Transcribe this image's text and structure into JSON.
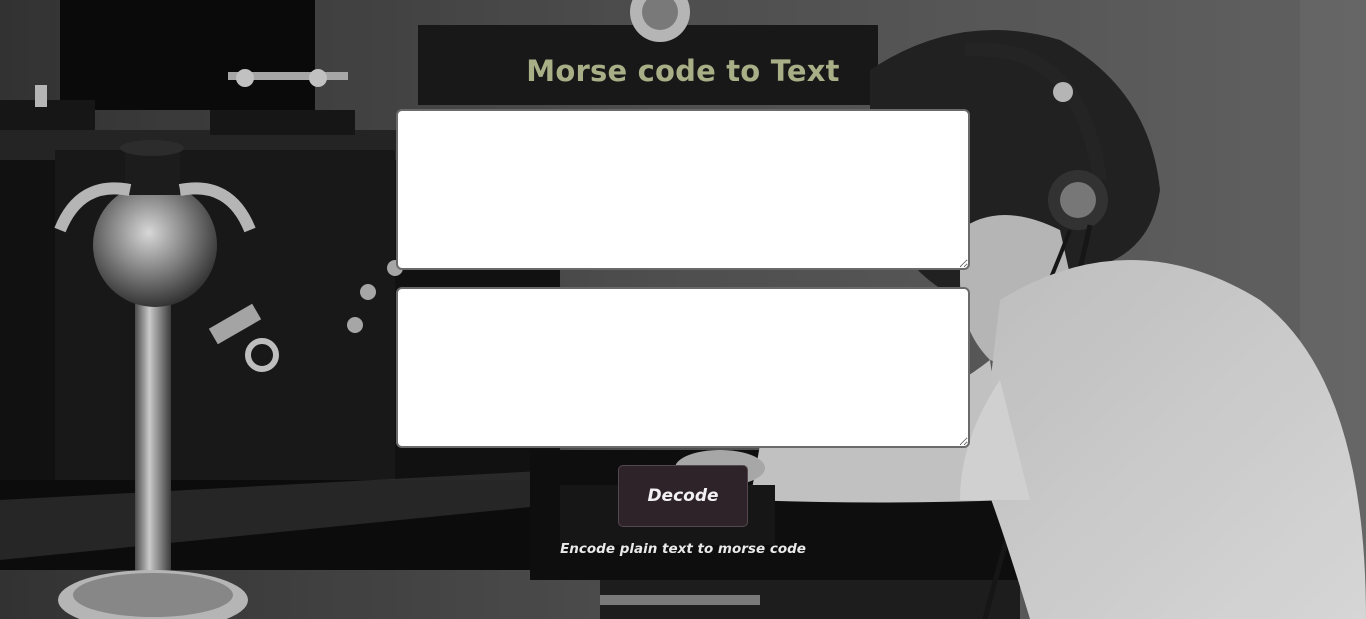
{
  "page": {
    "title": "Morse code to Text"
  },
  "input": {
    "value": "",
    "placeholder": ""
  },
  "output": {
    "value": "",
    "placeholder": ""
  },
  "actions": {
    "decode_label": "Decode",
    "switch_mode_label": "Encode plain text to morse code"
  },
  "colors": {
    "title": "#a8ae86",
    "button_bg": "#2e2328",
    "link_text": "#e9e9e9"
  }
}
